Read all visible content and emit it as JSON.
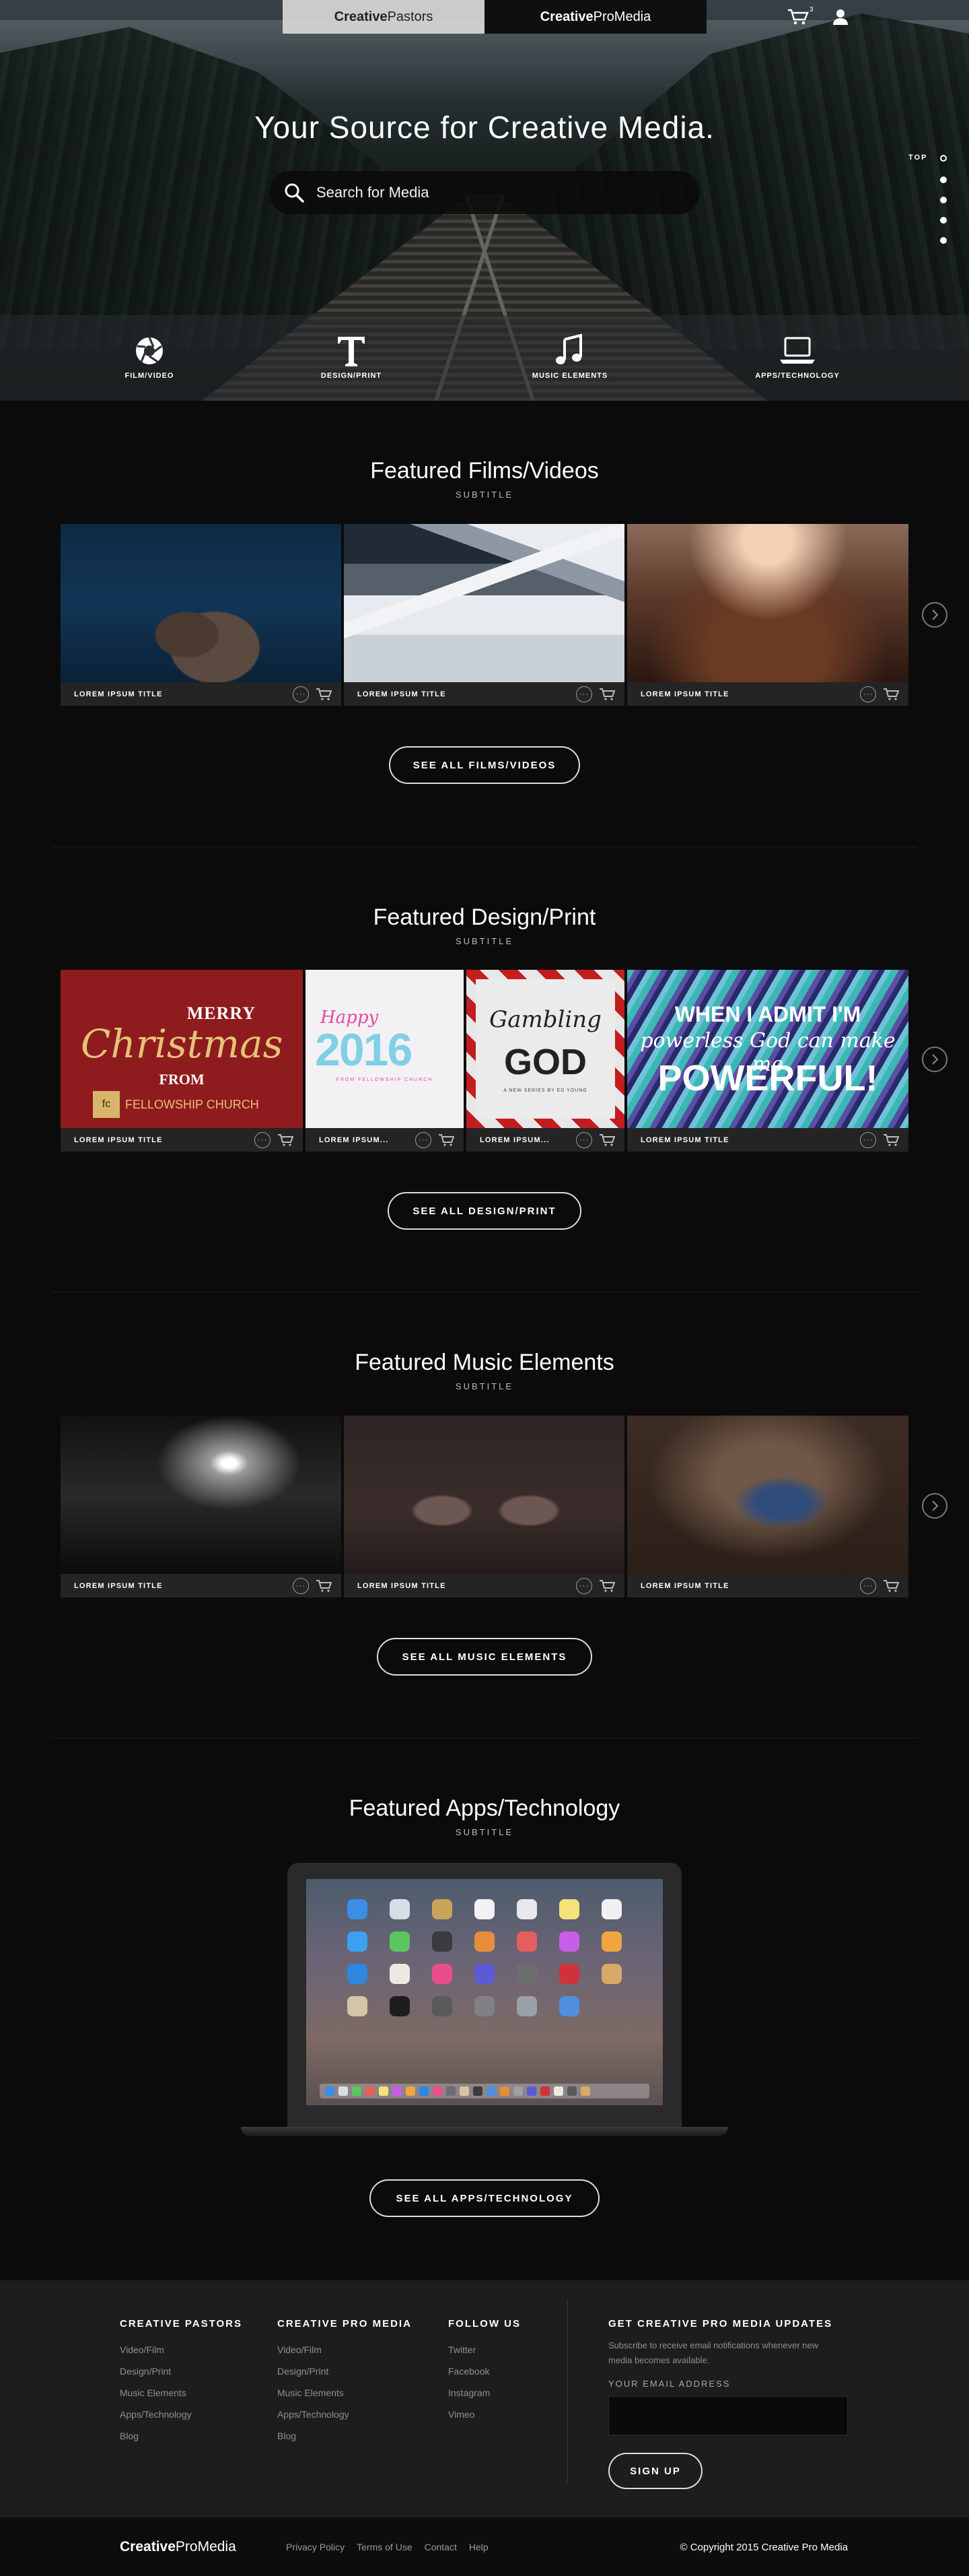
{
  "topbar": {
    "tab_left": {
      "bold": "Creative",
      "light": "Pastors"
    },
    "tab_right": {
      "bold": "Creative",
      "light": "ProMedia"
    },
    "cart_count": "3"
  },
  "hero": {
    "title": "Your Source for Creative Media.",
    "search_placeholder": "Search for Media",
    "top_label": "TOP",
    "categories": [
      {
        "label": "FILM/VIDEO",
        "icon": "camera-aperture-icon"
      },
      {
        "label": "DESIGN/PRINT",
        "icon": "type-t-icon"
      },
      {
        "label": "MUSIC ELEMENTS",
        "icon": "music-note-icon"
      },
      {
        "label": "APPS/TECHNOLOGY",
        "icon": "laptop-icon"
      }
    ]
  },
  "films": {
    "title": "Featured Films/Videos",
    "subtitle": "SUBTITLE",
    "cards": [
      {
        "title": "LOREM IPSUM TITLE"
      },
      {
        "title": "LOREM IPSUM TITLE"
      },
      {
        "title": "LOREM IPSUM TITLE"
      }
    ],
    "see_all": "SEE ALL FILMS/VIDEOS"
  },
  "design": {
    "title": "Featured Design/Print",
    "subtitle": "SUBTITLE",
    "cards": [
      {
        "title": "LOREM IPSUM TITLE",
        "art": {
          "merry": "MERRY",
          "script": "Christmas",
          "from": "FROM",
          "logo": "fc",
          "church": "FELLOWSHIP CHURCH"
        }
      },
      {
        "title": "LOREM IPSUM...",
        "art": {
          "happy": "Happy",
          "year": "2016",
          "sub": "FROM FELLOWSHIP CHURCH"
        }
      },
      {
        "title": "LOREM IPSUM...",
        "art": {
          "line1": "Gambling",
          "line2": "GOD",
          "sub": "A NEW SERIES BY ED YOUNG"
        }
      },
      {
        "title": "LOREM IPSUM TITLE",
        "art": {
          "line1": "WHEN I ADMIT I'M",
          "line2": "powerless God can make me",
          "line3": "POWERFUL!"
        }
      }
    ],
    "see_all": "SEE ALL DESIGN/PRINT"
  },
  "music": {
    "title": "Featured Music Elements",
    "subtitle": "SUBTITLE",
    "cards": [
      {
        "title": "LOREM IPSUM TITLE"
      },
      {
        "title": "LOREM IPSUM TITLE"
      },
      {
        "title": "LOREM IPSUM TITLE"
      }
    ],
    "see_all": "SEE ALL MUSIC ELEMENTS"
  },
  "apps": {
    "title": "Featured Apps/Technology",
    "subtitle": "SUBTITLE",
    "see_all": "SEE ALL APPS/TECHNOLOGY"
  },
  "footer": {
    "col1": {
      "heading": "CREATIVE PASTORS",
      "links": [
        "Video/Film",
        "Design/Print",
        "Music Elements",
        "Apps/Technology",
        "Blog"
      ]
    },
    "col2": {
      "heading": "CREATIVE PRO MEDIA",
      "links": [
        "Video/Film",
        "Design/Print",
        "Music Elements",
        "Apps/Technology",
        "Blog"
      ]
    },
    "col3": {
      "heading": "FOLLOW US",
      "links": [
        "Twitter",
        "Facebook",
        "Instagram",
        "Vimeo"
      ]
    },
    "newsletter": {
      "heading": "GET CREATIVE PRO MEDIA UPDATES",
      "text": "Subscribe to receive email notifications whenever new media becomes available.",
      "email_label": "YOUR EMAIL ADDRESS",
      "email_value": "",
      "button": "SIGN UP"
    }
  },
  "bottombar": {
    "brand": {
      "bold": "Creative",
      "light": "ProMedia"
    },
    "links": [
      "Privacy Policy",
      "Terms of Use",
      "Contact",
      "Help"
    ],
    "copyright": "© Copyright 2015 Creative Pro Media"
  },
  "colors": {
    "background": "#0b0b0c",
    "footer": "#1d1d1e",
    "accent_gold": "#e4c377"
  }
}
